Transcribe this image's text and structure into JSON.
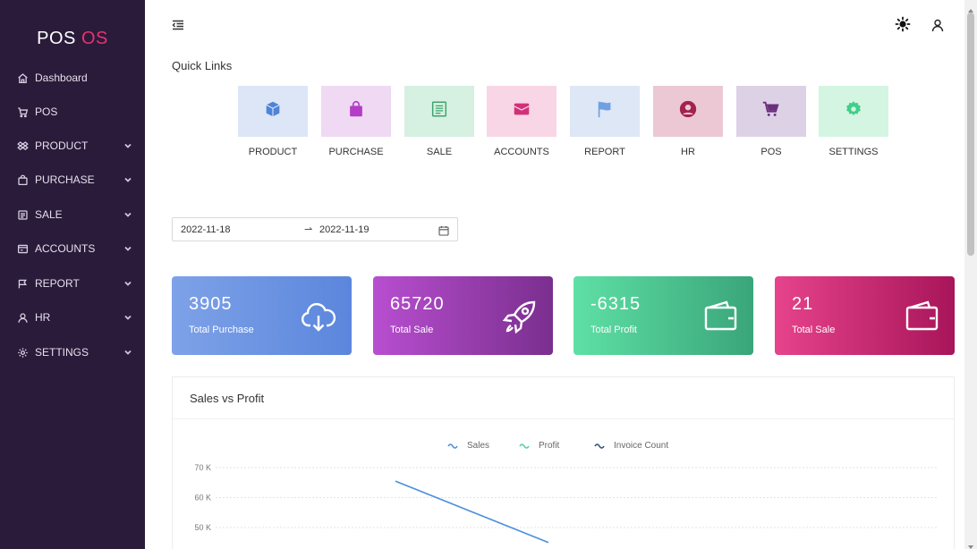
{
  "brand": {
    "part1": "POS",
    "part2": "OS"
  },
  "sidebar": {
    "items": [
      {
        "label": "Dashboard",
        "icon": "home-icon",
        "has_children": false
      },
      {
        "label": "POS",
        "icon": "cart-icon",
        "has_children": false
      },
      {
        "label": "PRODUCT",
        "icon": "dropbox-icon",
        "has_children": true
      },
      {
        "label": "PURCHASE",
        "icon": "shopping-bag-icon",
        "has_children": true
      },
      {
        "label": "SALE",
        "icon": "file-text-icon",
        "has_children": true
      },
      {
        "label": "ACCOUNTS",
        "icon": "card-icon",
        "has_children": true
      },
      {
        "label": "REPORT",
        "icon": "flag-icon",
        "has_children": true
      },
      {
        "label": "HR",
        "icon": "user-icon",
        "has_children": true
      },
      {
        "label": "SETTINGS",
        "icon": "gear-icon",
        "has_children": true
      }
    ]
  },
  "quick_links": {
    "title": "Quick Links",
    "items": [
      {
        "label": "PRODUCT",
        "icon": "cube-icon",
        "bg": "#dce6f7",
        "color": "#4f83d6"
      },
      {
        "label": "PURCHASE",
        "icon": "shopping-bag-icon",
        "bg": "#efd9f3",
        "color": "#b43cc7"
      },
      {
        "label": "SALE",
        "icon": "file-text-icon",
        "bg": "#d6f0e2",
        "color": "#3fa36c"
      },
      {
        "label": "ACCOUNTS",
        "icon": "wallet-icon",
        "bg": "#f8d6e5",
        "color": "#d2307a"
      },
      {
        "label": "REPORT",
        "icon": "flag-icon",
        "bg": "#dde7f5",
        "color": "#6fa0e3"
      },
      {
        "label": "HR",
        "icon": "user-circle-icon",
        "bg": "#ecc8d4",
        "color": "#a3234f"
      },
      {
        "label": "POS",
        "icon": "cart-icon",
        "bg": "#ddd1e6",
        "color": "#6a2f7c"
      },
      {
        "label": "SETTINGS",
        "icon": "gear-icon",
        "bg": "#d4f5e2",
        "color": "#3fcf8a"
      }
    ]
  },
  "date_range": {
    "start": "2022-11-18",
    "end": "2022-11-19",
    "separator": "⇀"
  },
  "stats": [
    {
      "value": "3905",
      "label": "Total Purchase",
      "icon": "cloud-download-icon",
      "from": "#7ea2e8",
      "to": "#5b86dc"
    },
    {
      "value": "65720",
      "label": "Total Sale",
      "icon": "rocket-icon",
      "from": "#b84ed0",
      "to": "#7a2f8e"
    },
    {
      "value": "-6315",
      "label": "Total Profit",
      "icon": "wallet-icon",
      "from": "#5ee0a5",
      "to": "#3aa57a"
    },
    {
      "value": "21",
      "label": "Total Sale",
      "icon": "wallet-icon",
      "from": "#e6438b",
      "to": "#a8155a"
    }
  ],
  "chart": {
    "title": "Sales vs Profit",
    "legend": [
      {
        "name": "Sales",
        "color": "#4a8fdb"
      },
      {
        "name": "Profit",
        "color": "#4fd1a2"
      },
      {
        "name": "Invoice Count",
        "color": "#2f4f7f"
      }
    ]
  },
  "chart_data": {
    "type": "line",
    "title": "Sales vs Profit",
    "xlabel": "",
    "ylabel": "",
    "y_ticks": [
      "70 K",
      "60 K",
      "50 K"
    ],
    "ylim_visible": [
      50000,
      70000
    ],
    "grid": true,
    "legend_position": "top-center",
    "series": [
      {
        "name": "Sales",
        "points": [
          [
            0,
            65500
          ],
          [
            1,
            45000
          ]
        ]
      },
      {
        "name": "Profit",
        "points": []
      },
      {
        "name": "Invoice Count",
        "points": []
      }
    ]
  }
}
